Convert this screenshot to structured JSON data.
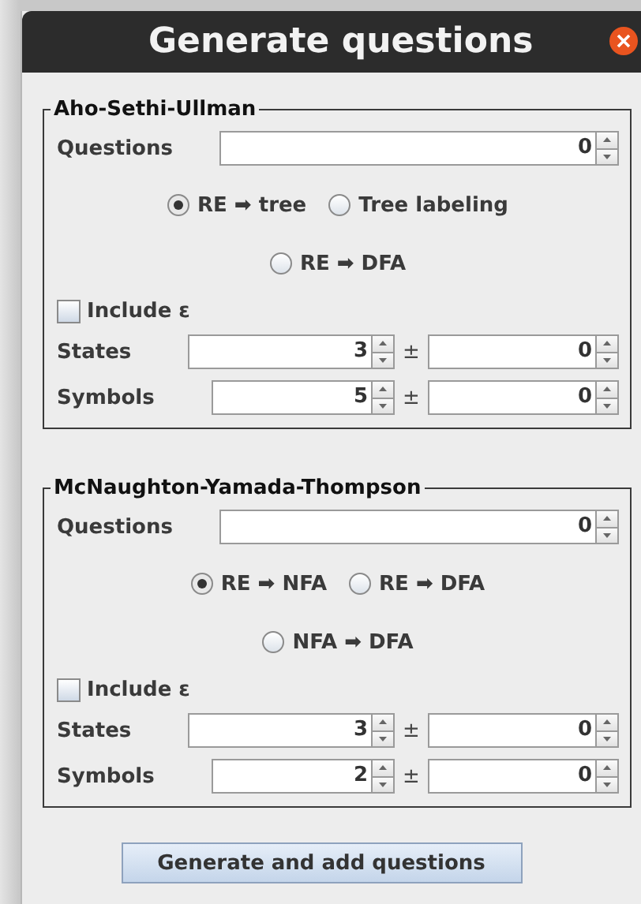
{
  "window": {
    "title": "Generate questions"
  },
  "groups": [
    {
      "title": "Aho-Sethi-Ullman",
      "questions": {
        "label": "Questions",
        "value": "0"
      },
      "options": [
        [
          {
            "label": "RE ➡ tree",
            "selected": true
          },
          {
            "label": "Tree labeling",
            "selected": false
          }
        ],
        [
          {
            "label": "RE ➡ DFA",
            "selected": false
          }
        ]
      ],
      "include": {
        "label": "Include ε",
        "checked": false
      },
      "rows": [
        {
          "label": "States",
          "value": "3",
          "sign": "±",
          "spread": "0"
        },
        {
          "label": "Symbols",
          "value": "5",
          "sign": "±",
          "spread": "0"
        }
      ]
    },
    {
      "title": "McNaughton-Yamada-Thompson",
      "questions": {
        "label": "Questions",
        "value": "0"
      },
      "options": [
        [
          {
            "label": "RE ➡ NFA",
            "selected": true
          },
          {
            "label": "RE ➡ DFA",
            "selected": false
          }
        ],
        [
          {
            "label": "NFA ➡ DFA",
            "selected": false
          }
        ]
      ],
      "include": {
        "label": "Include ε",
        "checked": false
      },
      "rows": [
        {
          "label": "States",
          "value": "3",
          "sign": "±",
          "spread": "0"
        },
        {
          "label": "Symbols",
          "value": "2",
          "sign": "±",
          "spread": "0"
        }
      ]
    }
  ],
  "button": "Generate and add questions"
}
